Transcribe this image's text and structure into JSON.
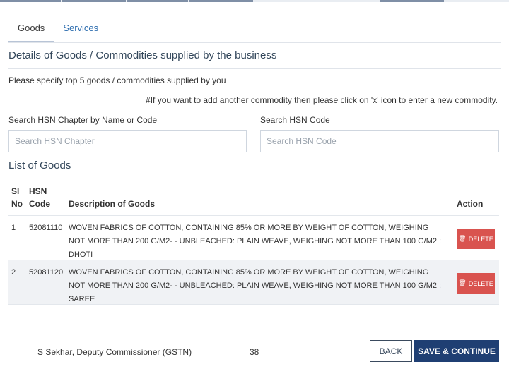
{
  "tabs": [
    {
      "label": "Goods",
      "active": true
    },
    {
      "label": "Services",
      "active": false
    }
  ],
  "section_title": "Details of Goods / Commodities supplied by the business",
  "instruction": "Please specify top 5 goods / commodities supplied by you",
  "note": "#If you want to add another commodity then please click on 'x' icon to enter a new commodity.",
  "search": {
    "chapter_label": "Search HSN Chapter by Name or Code",
    "chapter_placeholder": "Search HSN Chapter",
    "code_label": "Search HSN Code",
    "code_placeholder": "Search HSN Code"
  },
  "list_title": "List of Goods",
  "table": {
    "headers": {
      "sl_no": "Sl No",
      "hsn_code": "HSN Code",
      "description": "Description of Goods",
      "action": "Action"
    },
    "rows": [
      {
        "sl_no": "1",
        "hsn_code": "52081110",
        "description": "WOVEN FABRICS OF COTTON, CONTAINING 85% OR MORE BY WEIGHT OF COTTON, WEIGHING NOT MORE THAN 200 G/M2- - UNBLEACHED: PLAIN WEAVE, WEIGHING NOT MORE THAN 100 G/M2 : DHOTI",
        "action_label": "DELETE"
      },
      {
        "sl_no": "2",
        "hsn_code": "52081120",
        "description": "WOVEN FABRICS OF COTTON, CONTAINING 85% OR MORE BY WEIGHT OF COTTON, WEIGHING NOT MORE THAN 200 G/M2- - UNBLEACHED: PLAIN WEAVE, WEIGHING NOT MORE THAN 100 G/M2 : SAREE",
        "action_label": "DELETE"
      }
    ]
  },
  "footer": {
    "presenter": "S Sekhar, Deputy Commissioner (GSTN)",
    "page_number": "38"
  },
  "buttons": {
    "back": "BACK",
    "save": "SAVE & CONTINUE"
  },
  "colors": {
    "delete": "#d9534f",
    "primary": "#1f3f73",
    "tab_link": "#2f6fb0"
  },
  "icons": {
    "delete": "trash-icon"
  }
}
